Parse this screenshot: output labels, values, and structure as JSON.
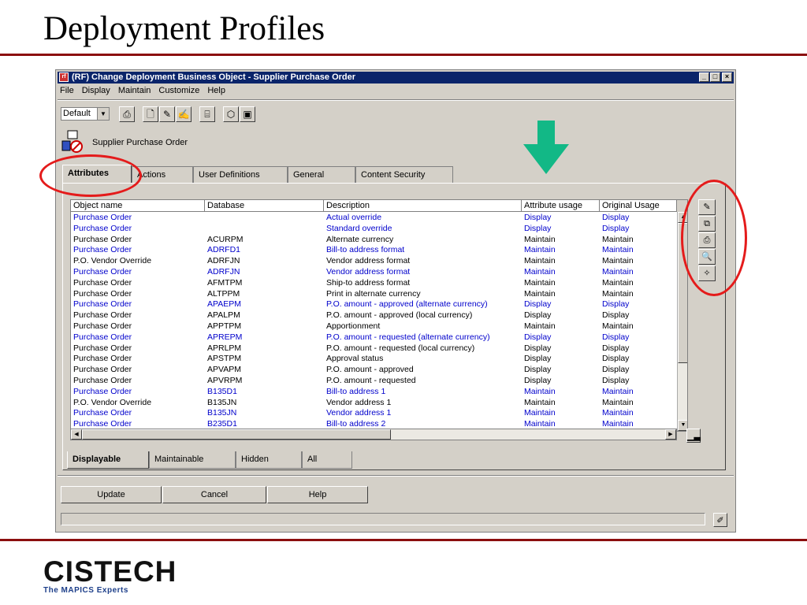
{
  "slide_title": "Deployment Profiles",
  "window": {
    "title": "(RF) Change Deployment Business Object - Supplier  Purchase Order",
    "controls": [
      "_",
      "□",
      "×"
    ]
  },
  "menu": [
    "File",
    "Display",
    "Maintain",
    "Customize",
    "Help"
  ],
  "toolbar": {
    "view_select": "Default",
    "buttons": [
      "printer-icon",
      "new-document-icon",
      "pencil-icon",
      "edit-list-icon",
      "tree-icon",
      "object-icon",
      "properties-icon"
    ]
  },
  "object_label": "Supplier  Purchase Order",
  "tabs": [
    "Attributes",
    "Actions",
    "User Definitions",
    "General",
    "Content Security"
  ],
  "grid": {
    "columns": [
      "Object name",
      "Database",
      "Description",
      "Attribute usage",
      "Original Usage"
    ],
    "rows": [
      {
        "name": "Purchase Order",
        "db": "",
        "desc": "Actual override",
        "usage": "Display",
        "orig": "Display",
        "blue": true
      },
      {
        "name": "Purchase Order",
        "db": "",
        "desc": "Standard override",
        "usage": "Display",
        "orig": "Display",
        "blue": true
      },
      {
        "name": "Purchase Order",
        "db": "ACURPM",
        "desc": "Alternate currency",
        "usage": "Maintain",
        "orig": "Maintain",
        "blue": false
      },
      {
        "name": "Purchase Order",
        "db": "ADRFD1",
        "desc": "Bill-to address format",
        "usage": "Maintain",
        "orig": "Maintain",
        "blue": true
      },
      {
        "name": "P.O. Vendor Override",
        "db": "ADRFJN",
        "desc": "Vendor address format",
        "usage": "Maintain",
        "orig": "Maintain",
        "blue": false
      },
      {
        "name": "Purchase Order",
        "db": "ADRFJN",
        "desc": "Vendor address format",
        "usage": "Maintain",
        "orig": "Maintain",
        "blue": true
      },
      {
        "name": "Purchase Order",
        "db": "AFMTPM",
        "desc": "Ship-to address format",
        "usage": "Maintain",
        "orig": "Maintain",
        "blue": false
      },
      {
        "name": "Purchase Order",
        "db": "ALTPPM",
        "desc": "Print in alternate currency",
        "usage": "Maintain",
        "orig": "Maintain",
        "blue": false
      },
      {
        "name": "Purchase Order",
        "db": "APAEPM",
        "desc": "P.O. amount - approved (alternate currency)",
        "usage": "Display",
        "orig": "Display",
        "blue": true
      },
      {
        "name": "Purchase Order",
        "db": "APALPM",
        "desc": "P.O. amount - approved (local currency)",
        "usage": "Display",
        "orig": "Display",
        "blue": false
      },
      {
        "name": "Purchase Order",
        "db": "APPTPM",
        "desc": "Apportionment",
        "usage": "Maintain",
        "orig": "Maintain",
        "blue": false
      },
      {
        "name": "Purchase Order",
        "db": "APREPM",
        "desc": "P.O. amount - requested (alternate currency)",
        "usage": "Display",
        "orig": "Display",
        "blue": true
      },
      {
        "name": "Purchase Order",
        "db": "APRLPM",
        "desc": "P.O. amount - requested (local currency)",
        "usage": "Display",
        "orig": "Display",
        "blue": false
      },
      {
        "name": "Purchase Order",
        "db": "APSTPM",
        "desc": "Approval status",
        "usage": "Display",
        "orig": "Display",
        "blue": false
      },
      {
        "name": "Purchase Order",
        "db": "APVAPM",
        "desc": "P.O. amount - approved",
        "usage": "Display",
        "orig": "Display",
        "blue": false
      },
      {
        "name": "Purchase Order",
        "db": "APVRPM",
        "desc": "P.O. amount - requested",
        "usage": "Display",
        "orig": "Display",
        "blue": false
      },
      {
        "name": "Purchase Order",
        "db": "B135D1",
        "desc": "Bill-to address 1",
        "usage": "Maintain",
        "orig": "Maintain",
        "blue": true
      },
      {
        "name": "P.O. Vendor Override",
        "db": "B135JN",
        "desc": "Vendor address 1",
        "usage": "Maintain",
        "orig": "Maintain",
        "blue": false
      },
      {
        "name": "Purchase Order",
        "db": "B135JN",
        "desc": "Vendor address 1",
        "usage": "Maintain",
        "orig": "Maintain",
        "blue": true
      },
      {
        "name": "Purchase Order",
        "db": "B235D1",
        "desc": "Bill-to address 2",
        "usage": "Maintain",
        "orig": "Maintain",
        "blue": true
      }
    ]
  },
  "bottom_tabs": [
    "Displayable",
    "Maintainable",
    "Hidden",
    "All"
  ],
  "buttons": {
    "update": "Update",
    "cancel": "Cancel",
    "help": "Help"
  },
  "logo": {
    "name": "CISTECH",
    "tagline": "The MAPICS Experts"
  },
  "colors": {
    "accent_red": "#8b0e0e",
    "circle_red": "#e41b1b",
    "arrow_green": "#12b886",
    "link_blue": "#0000cc"
  }
}
